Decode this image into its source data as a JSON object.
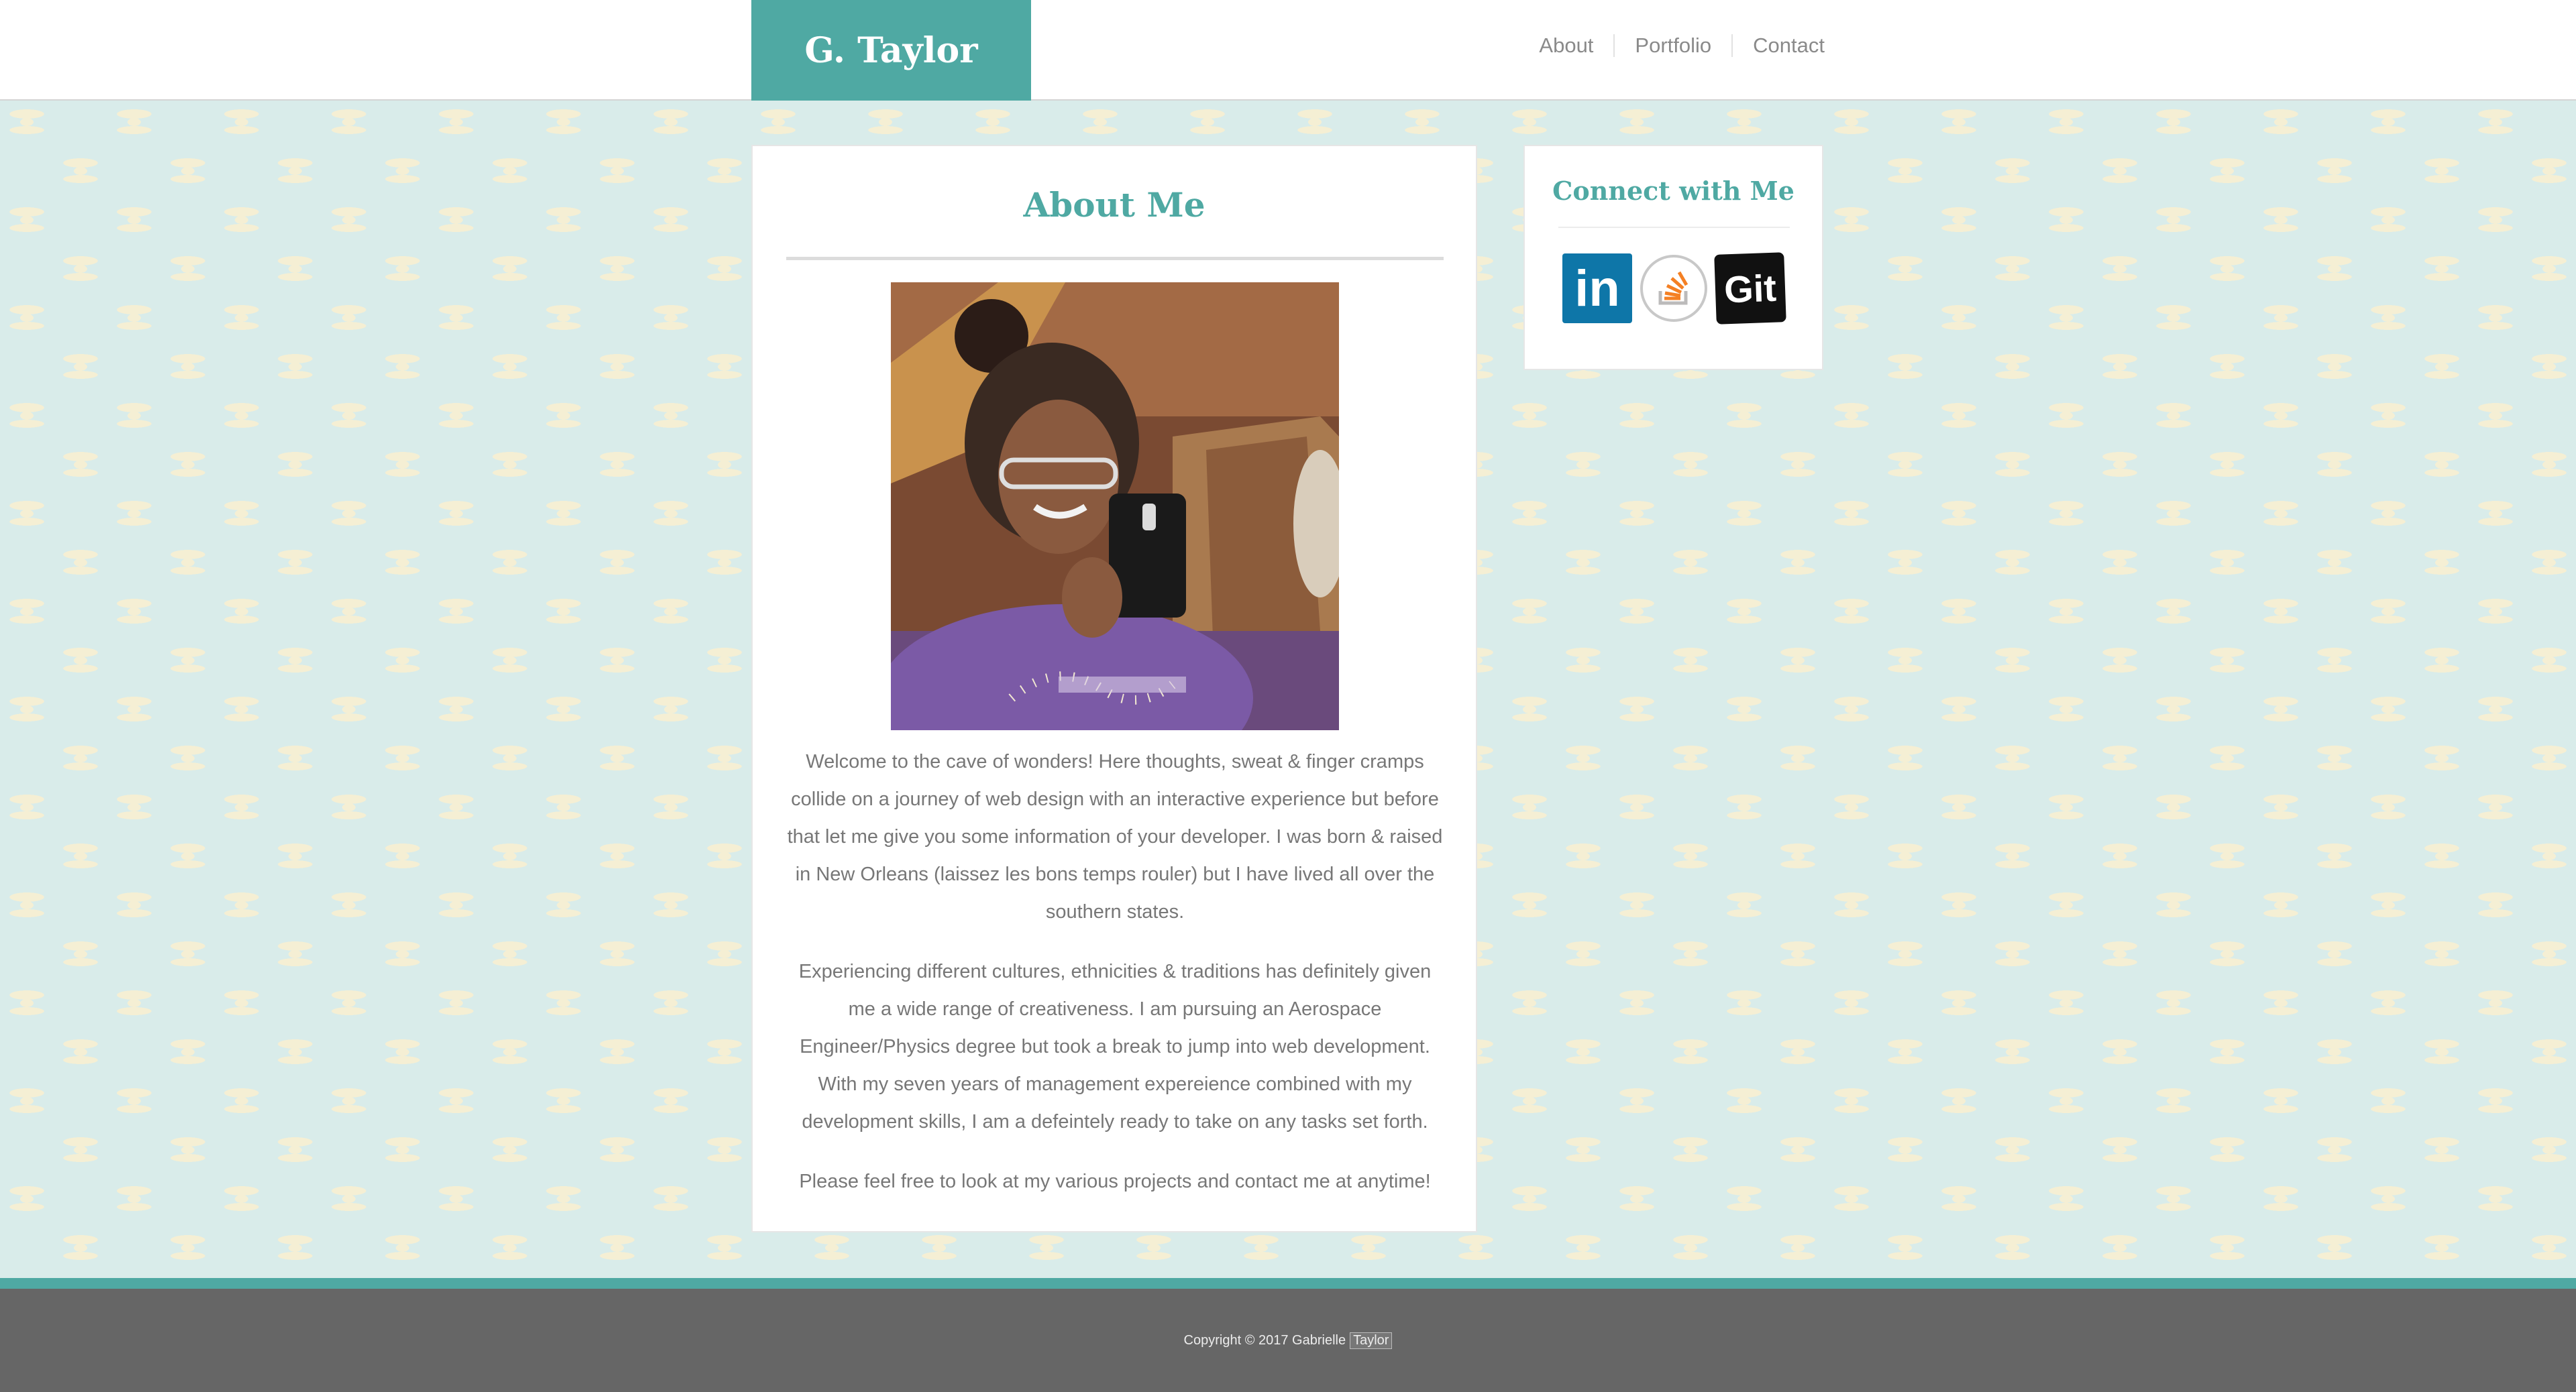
{
  "header": {
    "brand": "G. Taylor",
    "nav": [
      "About",
      "Portfolio",
      "Contact"
    ]
  },
  "about": {
    "title": "About Me",
    "photo_alt": "",
    "paragraphs": [
      "Welcome to the cave of wonders! Here thoughts, sweat & finger cramps collide on a journey of web design with an interactive experience but before that let me give you some information of your developer. I was born & raised in New Orleans (laissez les bons temps rouler) but I have lived all over the southern states.",
      "Experiencing different cultures, ethnicities & traditions has definitely given me a wide range of creativeness. I am pursuing an Aerospace Engineer/Physics degree but took a break to jump into web development. With my seven years of management expereience combined with my development skills, I am a defeintely ready to take on any tasks set forth.",
      "Please feel free to look at my various projects and contact me at anytime!"
    ]
  },
  "sidebar": {
    "title": "Connect with Me",
    "links": [
      {
        "label": "in",
        "icon": "linkedin-icon"
      },
      {
        "label": "",
        "icon": "stackoverflow-icon"
      },
      {
        "label": "Git",
        "icon": "git-icon"
      }
    ]
  },
  "footer": {
    "copyright": "Copyright © 2017 Gabrielle",
    "surname": "Taylor"
  },
  "colors": {
    "accent": "#4fa9a3",
    "background": "#d9ecea",
    "footer": "#666666"
  }
}
